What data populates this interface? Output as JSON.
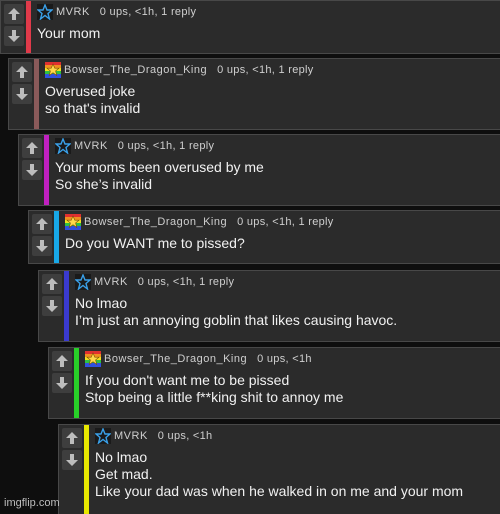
{
  "colors": {
    "panel": "#2b2b2b",
    "bar_1": "#e03a4a",
    "bar_2": "#8a5a5a",
    "bar_3": "#c020c0",
    "bar_4": "#18a8e8",
    "bar_5": "#3a3ad0",
    "bar_6": "#28d028",
    "bar_7": "#e8e800"
  },
  "icons": {
    "upvote": "up-arrow-icon",
    "downvote": "down-arrow-icon",
    "mvrk_avatar": "blue-star-icon",
    "bowser_avatar": "rainbow-star-icon"
  },
  "comments": [
    {
      "user": "MVRK",
      "stats": "0 ups, <1h, 1 reply",
      "lines": [
        "Your mom"
      ]
    },
    {
      "user": "Bowser_The_Dragon_King",
      "stats": "0 ups, <1h, 1 reply",
      "lines": [
        "Overused joke",
        "so that's invalid"
      ]
    },
    {
      "user": "MVRK",
      "stats": "0 ups, <1h, 1 reply",
      "lines": [
        "Your moms been overused by me",
        "So she’s invalid"
      ]
    },
    {
      "user": "Bowser_The_Dragon_King",
      "stats": "0 ups, <1h, 1 reply",
      "lines": [
        "Do you WANT me to pissed?"
      ]
    },
    {
      "user": "MVRK",
      "stats": "0 ups, <1h, 1 reply",
      "lines": [
        "No lmao",
        "I’m just an annoying goblin that likes causing havoc."
      ]
    },
    {
      "user": "Bowser_The_Dragon_King",
      "stats": "0 ups, <1h",
      "lines": [
        "If you don't want me to be pissed",
        "Stop being a little f**king shit to annoy me"
      ]
    },
    {
      "user": "MVRK",
      "stats": "0 ups, <1h",
      "lines": [
        "No lmao",
        "Get mad.",
        "Like your dad was when he walked in on me and your mom"
      ]
    }
  ],
  "watermark": "imgflip.com"
}
